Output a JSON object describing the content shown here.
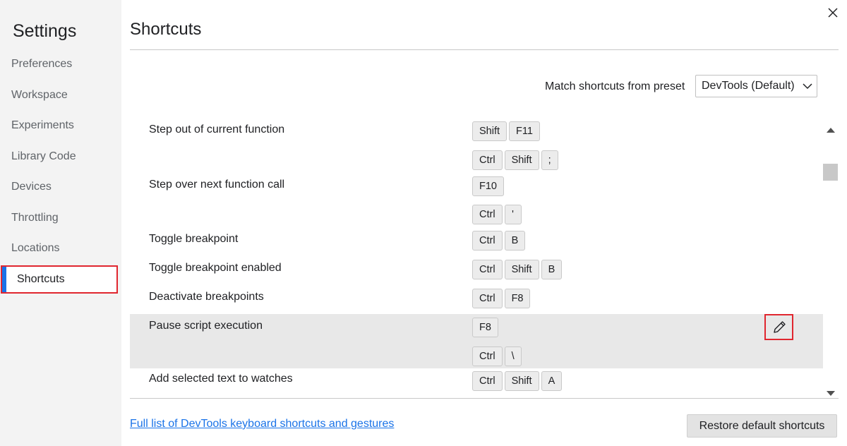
{
  "sidebar": {
    "title": "Settings",
    "items": [
      {
        "label": "Preferences"
      },
      {
        "label": "Workspace"
      },
      {
        "label": "Experiments"
      },
      {
        "label": "Library Code"
      },
      {
        "label": "Devices"
      },
      {
        "label": "Throttling"
      },
      {
        "label": "Locations"
      },
      {
        "label": "Shortcuts"
      }
    ],
    "active_index": 7
  },
  "header": {
    "title": "Shortcuts",
    "close_icon": "close-icon"
  },
  "preset": {
    "label": "Match shortcuts from preset",
    "selected": "DevTools (Default)"
  },
  "shortcuts": [
    {
      "action": "Step out of current function",
      "bindings": [
        [
          "Shift",
          "F11"
        ],
        [
          "Ctrl",
          "Shift",
          ";"
        ]
      ]
    },
    {
      "action": "Step over next function call",
      "bindings": [
        [
          "F10"
        ],
        [
          "Ctrl",
          "'"
        ]
      ]
    },
    {
      "action": "Toggle breakpoint",
      "bindings": [
        [
          "Ctrl",
          "B"
        ]
      ]
    },
    {
      "action": "Toggle breakpoint enabled",
      "bindings": [
        [
          "Ctrl",
          "Shift",
          "B"
        ]
      ]
    },
    {
      "action": "Deactivate breakpoints",
      "bindings": [
        [
          "Ctrl",
          "F8"
        ]
      ]
    },
    {
      "action": "Pause script execution",
      "bindings": [
        [
          "F8"
        ],
        [
          "Ctrl",
          "\\"
        ]
      ],
      "highlighted": true,
      "edit_icon": "pencil-icon"
    },
    {
      "action": "Add selected text to watches",
      "bindings": [
        [
          "Ctrl",
          "Shift",
          "A"
        ]
      ]
    }
  ],
  "footer": {
    "link_text": "Full list of DevTools keyboard shortcuts and gestures",
    "restore_label": "Restore default shortcuts"
  },
  "colors": {
    "accent_blue": "#1a73e8",
    "highlight_red": "#e0262f",
    "row_highlight": "#e8e8e8",
    "sidebar_bg": "#f3f3f3"
  }
}
